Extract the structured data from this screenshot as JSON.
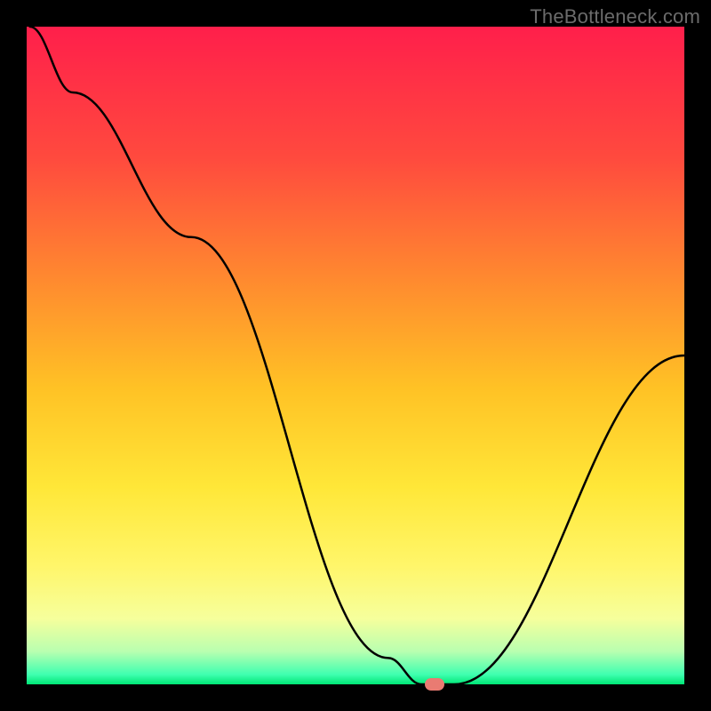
{
  "watermark": "TheBottleneck.com",
  "chart_data": {
    "type": "line",
    "title": "",
    "xlabel": "",
    "ylabel": "",
    "xlim": [
      0,
      100
    ],
    "ylim": [
      0,
      100
    ],
    "x": [
      0.5,
      7,
      25,
      55,
      60,
      65,
      100
    ],
    "values": [
      100,
      90,
      68,
      4,
      0,
      0,
      50
    ],
    "marker": {
      "x": 62,
      "y": 0
    },
    "background_gradient": {
      "stops": [
        {
          "pos": 0.0,
          "color": "#ff1f4b"
        },
        {
          "pos": 0.2,
          "color": "#ff4a3e"
        },
        {
          "pos": 0.4,
          "color": "#ff8f2e"
        },
        {
          "pos": 0.55,
          "color": "#ffc225"
        },
        {
          "pos": 0.7,
          "color": "#ffe738"
        },
        {
          "pos": 0.82,
          "color": "#fff66a"
        },
        {
          "pos": 0.9,
          "color": "#f6ff9c"
        },
        {
          "pos": 0.95,
          "color": "#b9ffb0"
        },
        {
          "pos": 0.985,
          "color": "#3fffb0"
        },
        {
          "pos": 1.0,
          "color": "#00e676"
        }
      ]
    },
    "colors": {
      "curve": "#000000",
      "marker": "#e97b72",
      "frame": "#000000"
    }
  }
}
